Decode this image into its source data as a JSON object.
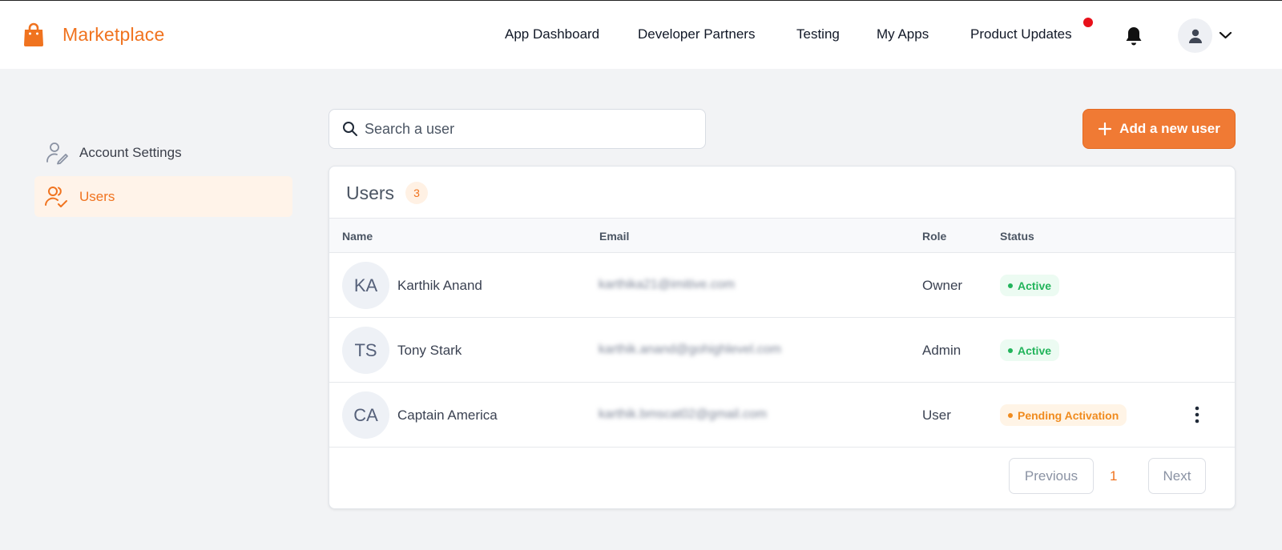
{
  "header": {
    "brand": "Marketplace",
    "nav": [
      {
        "label": "App Dashboard"
      },
      {
        "label": "Developer Partners"
      },
      {
        "label": "Testing"
      },
      {
        "label": "My Apps"
      },
      {
        "label": "Product Updates",
        "has_notification_dot": true
      }
    ],
    "icons": {
      "logo": "shopping-bag-icon",
      "bell": "bell-icon",
      "avatar": "user-icon",
      "chevron": "chevron-down-icon"
    }
  },
  "sidebar": {
    "items": [
      {
        "label": "Account Settings",
        "icon": "user-edit-icon",
        "active": false
      },
      {
        "label": "Users",
        "icon": "users-check-icon",
        "active": true
      }
    ]
  },
  "search": {
    "placeholder": "Search a user",
    "value": ""
  },
  "add_user": {
    "label": "Add a new user",
    "icon": "plus-icon"
  },
  "users_card": {
    "title": "Users",
    "count": "3",
    "columns": [
      "Name",
      "Email",
      "Role",
      "Status"
    ],
    "rows": [
      {
        "initials": "KA",
        "name": "Karthik Anand",
        "email": "karthika21@imitive.com",
        "role": "Owner",
        "status": "Active"
      },
      {
        "initials": "TS",
        "name": "Tony Stark",
        "email": "karthik.anand@gohighlevel.com",
        "role": "Admin",
        "status": "Active"
      },
      {
        "initials": "CA",
        "name": "Captain America",
        "email": "karthik.bmscat02@gmail.com",
        "role": "User",
        "status": "Pending Activation",
        "has_menu": true
      }
    ],
    "pagination": {
      "previous": "Previous",
      "current": "1",
      "next": "Next"
    }
  },
  "colors": {
    "accent": "#f0731f",
    "active": "#22b45b",
    "pending": "#f08b1e",
    "notification": "#e8101a"
  }
}
